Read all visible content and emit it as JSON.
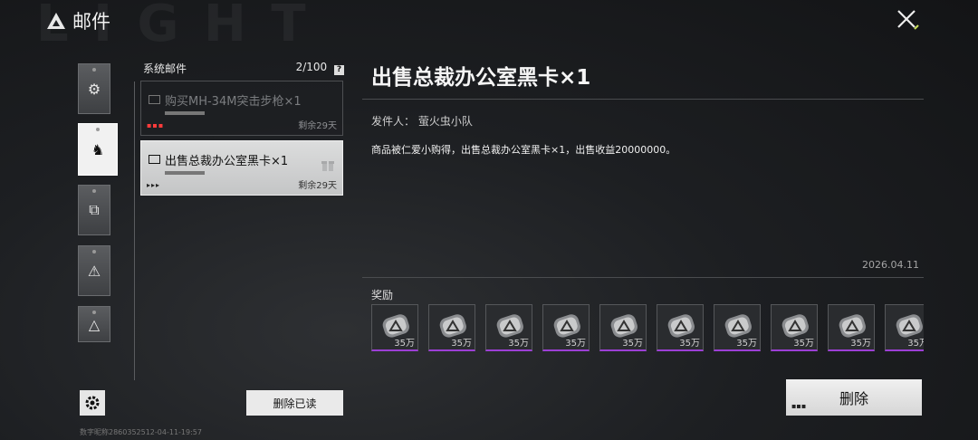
{
  "header": {
    "title": "邮件",
    "watermark": "L I G H T"
  },
  "categories": [
    {
      "name": "settings",
      "glyph": "⚙"
    },
    {
      "name": "system",
      "glyph": "♞"
    },
    {
      "name": "puzzle",
      "glyph": "⧉"
    },
    {
      "name": "warning",
      "glyph": "⚠"
    },
    {
      "name": "triangle",
      "glyph": "△"
    }
  ],
  "mail_list": {
    "title": "系统邮件",
    "count": "2/100",
    "help_glyph": "?",
    "items": [
      {
        "subject": "购买MH-34M突击步枪×1",
        "remain": "剩余29天",
        "dots": "▪▪▪",
        "state": "read"
      },
      {
        "subject": "出售总裁办公室黑卡×1",
        "remain": "剩余29天",
        "dots": "▸▸▸",
        "state": "selected"
      }
    ]
  },
  "buttons": {
    "delete_read": "删除已读",
    "delete": "删除",
    "delete_dots": "▪▪▪"
  },
  "footer": {
    "user_id": "数字昵称2860352512-04-11-19:57"
  },
  "detail": {
    "title": "出售总裁办公室黑卡×1",
    "sender_label": "发件人：",
    "sender": "萤火虫小队",
    "body": "商品被仁爱小购得，出售总裁办公室黑卡×1，出售收益20000000。",
    "date": "2026.04.11",
    "reward_label": "奖励",
    "rewards": [
      {
        "qty": "35万"
      },
      {
        "qty": "35万"
      },
      {
        "qty": "35万"
      },
      {
        "qty": "35万"
      },
      {
        "qty": "35万"
      },
      {
        "qty": "35万"
      },
      {
        "qty": "35万"
      },
      {
        "qty": "35万"
      },
      {
        "qty": "35万"
      },
      {
        "qty": "35万"
      }
    ]
  },
  "colors": {
    "reward_rarity": "#9c3fd6",
    "read_dots": "#ff3b3b",
    "close_accent": "#c8e05a"
  }
}
